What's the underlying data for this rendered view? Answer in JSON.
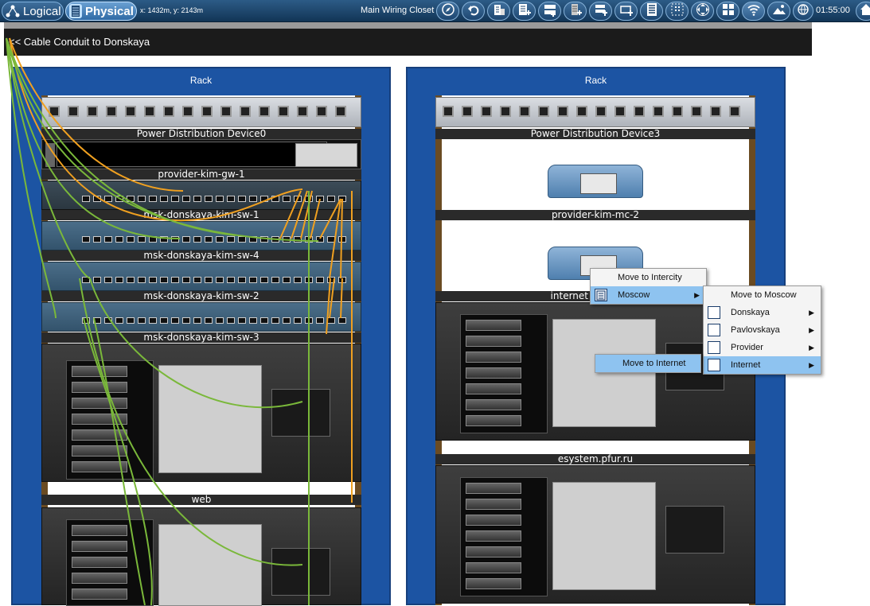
{
  "toolbar": {
    "logical_label": "Logical",
    "physical_label": "Physical",
    "coords": "x: 1432m, y: 2143m",
    "location": "Main Wiring Closet",
    "clock": "01:55:00",
    "icons": [
      "navigation-icon",
      "back-icon",
      "building-icon",
      "add-closet-icon",
      "rack-icon",
      "add-rack-icon",
      "add-device-icon",
      "table-icon",
      "cabinet-icon",
      "grid-icon",
      "move-icon",
      "tiles-icon",
      "wireless-icon",
      "landscape-icon",
      "globe-icon",
      "home-icon"
    ]
  },
  "conduit": {
    "label": "<< Cable Conduit to Donskaya"
  },
  "racks": [
    {
      "title": "Rack",
      "devices": [
        {
          "label": "Power Distribution Device0"
        },
        {
          "label": "provider-kim-gw-1"
        },
        {
          "label": "msk-donskaya-kim-sw-1"
        },
        {
          "label": "msk-donskaya-kim-sw-4"
        },
        {
          "label": "msk-donskaya-kim-sw-2"
        },
        {
          "label": "msk-donskaya-kim-sw-3"
        },
        {
          "label": "web"
        }
      ]
    },
    {
      "title": "Rack",
      "devices": [
        {
          "label": "Power Distribution Device3"
        },
        {
          "label": "provider-kim-mc-2"
        },
        {
          "label": "internet"
        },
        {
          "label": "esystem.pfur.ru"
        }
      ]
    }
  ],
  "context_menu": {
    "menu1": [
      {
        "label": "Move to Intercity",
        "icon": "",
        "submenu": false,
        "highlight": false
      },
      {
        "label": "Moscow",
        "icon": "building-icon",
        "submenu": true,
        "highlight": true
      }
    ],
    "menu2": [
      {
        "label": "Move to Moscow",
        "icon": "",
        "submenu": false,
        "highlight": false
      },
      {
        "label": "Donskaya",
        "icon": "closet-icon",
        "submenu": true,
        "highlight": false
      },
      {
        "label": "Pavlovskaya",
        "icon": "closet-icon",
        "submenu": true,
        "highlight": false
      },
      {
        "label": "Provider",
        "icon": "closet-icon",
        "submenu": true,
        "highlight": false
      },
      {
        "label": "Internet",
        "icon": "closet-icon",
        "submenu": true,
        "highlight": true
      }
    ],
    "menu3": [
      {
        "label": "Move to Internet",
        "icon": "",
        "submenu": false,
        "highlight": true
      }
    ]
  },
  "colors": {
    "rack_blue": "#1c54a3",
    "toolbar": "#1f4a74",
    "menu_highlight": "#8ec3f0",
    "cable_orange": "#f0a020",
    "cable_green": "#7ab83a"
  }
}
